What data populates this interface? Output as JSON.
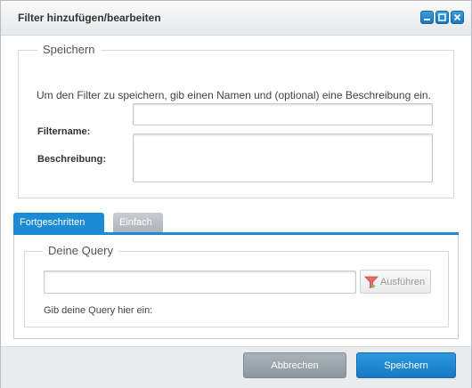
{
  "window": {
    "title": "Filter hinzufügen/bearbeiten",
    "buttons": [
      "minimize-icon",
      "maximize-icon",
      "close-icon"
    ]
  },
  "save_section": {
    "legend": "Speichern",
    "hint": "Um den Filter zu speichern, gib einen Namen und (optional) eine Beschreibung ein.",
    "filtername_label": "Filtername:",
    "filtername_value": "",
    "beschreibung_label": "Beschreibung:",
    "beschreibung_value": ""
  },
  "tabs": [
    {
      "label": "Fortgeschritten",
      "active": true
    },
    {
      "label": "Einfach",
      "active": false
    }
  ],
  "query_section": {
    "legend": "Deine Query",
    "query_value": "",
    "run_label": "Ausführen",
    "run_icon": "filter-run-icon",
    "hint": "Gib deine Query hier ein:"
  },
  "footer": {
    "cancel_label": "Abbrechen",
    "save_label": "Speichern"
  },
  "colors": {
    "accent": "#1d8ad6",
    "cancel": "#97a1aa",
    "run_icon": "#e05050"
  }
}
